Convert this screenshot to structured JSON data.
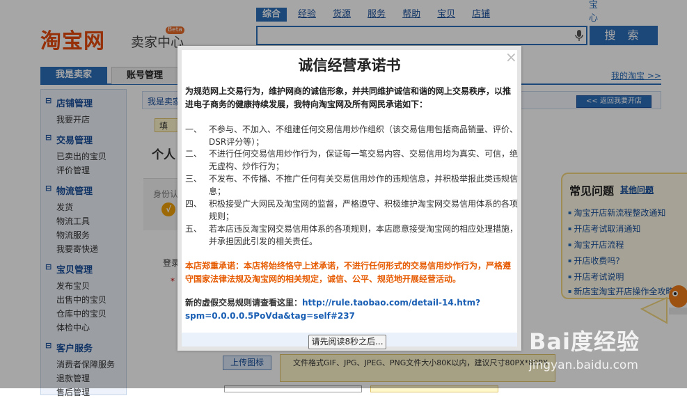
{
  "header": {
    "logo_text": "淘宝网",
    "logo_sub": "卖家中心",
    "beta": "Beta",
    "search_tabs": [
      "综合",
      "经验",
      "货源",
      "服务",
      "帮助",
      "宝贝",
      "店铺"
    ],
    "search_button": "搜 索",
    "top_links": [
      "宝",
      "心"
    ]
  },
  "nav": {
    "tabs": [
      "我是卖家",
      "账号管理"
    ],
    "my_taobao": "我的淘宝 >>"
  },
  "sidebar": {
    "sections": [
      {
        "title": "店铺管理",
        "items": [
          "我要开店"
        ]
      },
      {
        "title": "交易管理",
        "items": [
          "已卖出的宝贝",
          "评价管理"
        ]
      },
      {
        "title": "物流管理",
        "items": [
          "发货",
          "物流工具",
          "物流服务",
          "我要寄快递"
        ]
      },
      {
        "title": "宝贝管理",
        "items": [
          "发布宝贝",
          "出售中的宝贝",
          "仓库中的宝贝",
          "体检中心"
        ]
      },
      {
        "title": "客户服务",
        "items": [
          "消费者保障服务",
          "退款管理",
          "售后管理"
        ]
      }
    ]
  },
  "main": {
    "crumb": "我是卖家",
    "back_button": "<< 返回我要开店",
    "tip_fill": "填",
    "page_title": "个人",
    "id_label": "身份认",
    "login_label": "登录",
    "req_star": "*",
    "upload_button": "上传图标",
    "upload_note": "文件格式GIF、JPG、JPEG、PNG文件大小80K以内，建议尺寸80PX*80PX"
  },
  "help": {
    "title": "常见问题",
    "more": "其他问题",
    "items": [
      "淘宝开店新流程整改通知",
      "开店考试取消通知",
      "淘宝开店流程",
      "开店收费吗?",
      "开店考试说明",
      "新店宝淘宝开店操作全攻略"
    ]
  },
  "modal": {
    "title": "诚信经营承诺书",
    "intro": "为规范网上交易行为，维护网商的诚信形象，并共同维护诚信和谐的网上交易秩序，以推进电子商务的健康持续发展，我特向淘宝网及所有网民承诺如下：",
    "items": [
      {
        "num": "一、",
        "text": "不参与、不加入、不组建任何交易信用炒作组织（该交易信用包括商品销量、评价、DSR评分等）；"
      },
      {
        "num": "二、",
        "text": "不进行任何交易信用炒作行为，保证每一笔交易内容、交易信用均为真实、可信，绝无虚构、炒作行为；"
      },
      {
        "num": "三、",
        "text": "不发布、不传播、不推广任何有关交易信用炒作的违规信息，并积极举报此类违规信息；"
      },
      {
        "num": "四、",
        "text": "积极接受广大网民及淘宝网的监督，严格遵守、积极维护淘宝网交易信用体系的各项规则；"
      },
      {
        "num": "五、",
        "text": "若本店违反淘宝网交易信用体系的各项规则，本店愿意接受淘宝网的相应处理措施，并承担因此引发的相关责任。"
      }
    ],
    "important": "本店郑重承诺：本店将始终恪守上述承诺，不进行任何形式的交易信用炒作行为，严格遵守国家法律法规及淘宝网的相关规定，诚信、公平、规范地开展经营活动。",
    "rule_prefix": "新的虚假交易规则请查看这里：",
    "rule_link": "http://rule.taobao.com/detail-14.htm?spm=0.0.0.0.5PoVda&tag=self#237",
    "read_button": "请先阅读8秒之后...",
    "close": "×"
  },
  "watermark": {
    "brand": "Bai度经验",
    "url": "jingyan.baidu.com"
  },
  "colors": {
    "accent": "#2a6dbb",
    "logo": "#e64b0e",
    "warning": "#e65a00"
  }
}
